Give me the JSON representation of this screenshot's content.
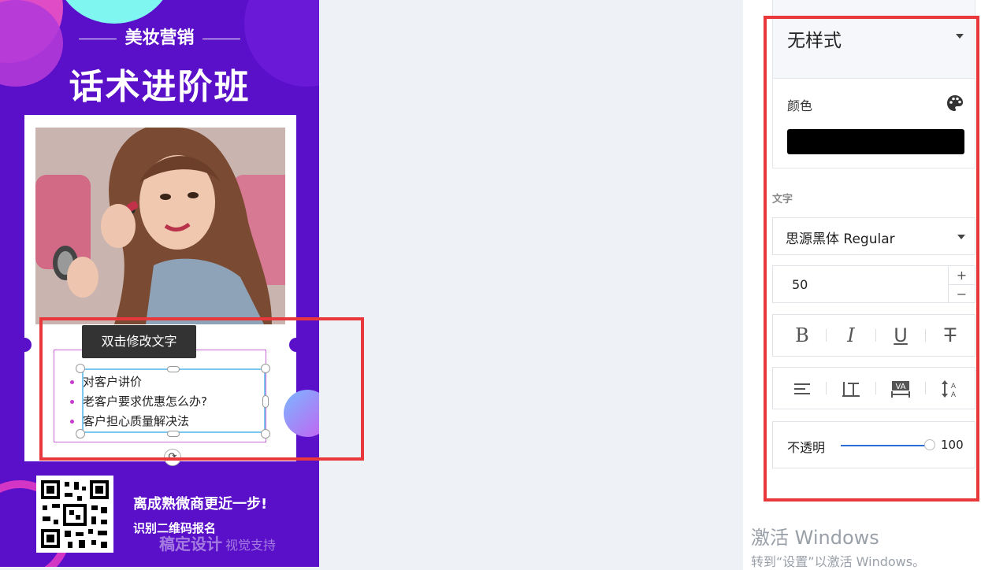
{
  "poster": {
    "subtitle": "美妆营销",
    "title": "话术进阶班",
    "tooltip": "双击修改文字",
    "bullets": [
      "对客户讲价",
      "老客户要求优惠怎么办?",
      "客户担心质量解决法"
    ],
    "cta_line1": "离成熟微商更近一步!",
    "cta_line2": "识别二维码报名",
    "watermark": "稿定设计",
    "watermark_suffix": "视觉支持"
  },
  "panel": {
    "style_value": "无样式",
    "color_label": "颜色",
    "color_value": "#000000",
    "section_text": "文字",
    "font_value": "思源黑体 Regular",
    "font_size": "50",
    "stepper_plus": "+",
    "stepper_minus": "−",
    "opacity_label": "不透明",
    "opacity_value": "100",
    "format_buttons": [
      "B",
      "I",
      "U",
      "T"
    ]
  },
  "os": {
    "activate_title": "激活 Windows",
    "activate_sub": "转到“设置”以激活 Windows。"
  },
  "colors": {
    "poster_bg": "#5a0fc8",
    "highlight": "#e8383b",
    "selection": "#7bc7ee"
  }
}
